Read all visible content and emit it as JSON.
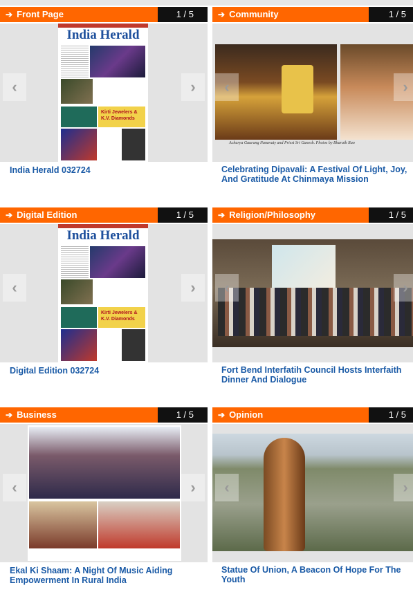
{
  "cards": [
    {
      "category": "Front Page",
      "counter": "1 / 5",
      "title": "India Herald 032724",
      "thumb": "newspaper-front-page"
    },
    {
      "category": "Community",
      "counter": "1 / 5",
      "title": "Celebrating Dipavali: A Festival Of Light, Joy, And Gratitude At Chinmaya Mission",
      "thumb": "dipavali-photos",
      "caption": "Acharya Gaurang Nanavaty and Priest Sri Ganesh. Photos by Bharath Rao"
    },
    {
      "category": "Digital Edition",
      "counter": "1 / 5",
      "title": "Digital Edition 032724",
      "thumb": "newspaper-front-page"
    },
    {
      "category": "Religion/Philosophy",
      "counter": "1 / 5",
      "title": "Fort Bend Interfatih Council Hosts Interfaith Dinner And Dialogue",
      "thumb": "interfaith-group-photo"
    },
    {
      "category": "Business",
      "counter": "1 / 5",
      "title": "Ekal Ki Shaam: A Night Of Music Aiding Empowerment In Rural India",
      "thumb": "ekal-group-photos"
    },
    {
      "category": "Opinion",
      "counter": "1 / 5",
      "title": "Statue Of Union, A Beacon Of Hope For The Youth",
      "thumb": "hanuman-statue-photo"
    }
  ],
  "newspaper": {
    "masthead": "India Herald",
    "ad_label": "Kirti Jewelers & K.V. Diamonds"
  },
  "icons": {
    "category_arrow": "arrow-right-icon",
    "prev": "chevron-left-icon",
    "next": "chevron-right-icon"
  },
  "colors": {
    "category_bg": "#ff6600",
    "header_bg": "#111111",
    "title": "#1a5aa6"
  }
}
